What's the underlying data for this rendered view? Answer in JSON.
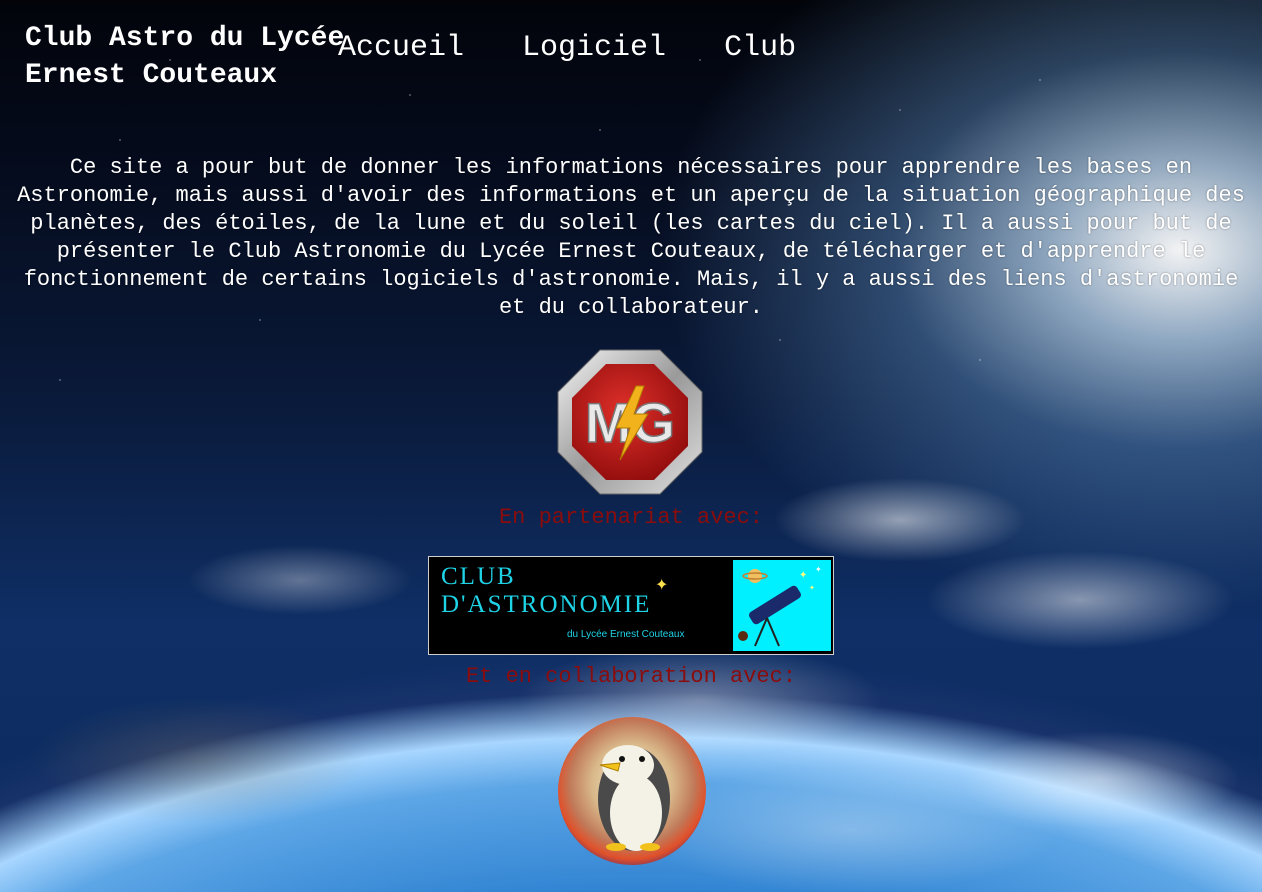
{
  "site": {
    "title": "Club Astro du Lycée Ernest Couteaux"
  },
  "nav": {
    "items": [
      {
        "label": "Accueil"
      },
      {
        "label": "Logiciel"
      },
      {
        "label": "Club"
      }
    ]
  },
  "intro": {
    "text": "Ce site a pour but de donner les informations nécessaires pour apprendre les bases en Astronomie, mais aussi d'avoir des informations et un aperçu de la situation géographique des planètes, des étoiles, de la lune et du soleil (les cartes du ciel). Il a aussi pour but de présenter le Club Astronomie du Lycée Ernest Couteaux, de télécharger et d'apprendre le fonctionnement de certains logiciels d'astronomie. Mais, il y a aussi des liens d'astronomie et du collaborateur."
  },
  "logos": {
    "mg": {
      "text": "MG"
    },
    "club_banner": {
      "line1": "CLUB",
      "line2": "D'ASTRONOMIE",
      "subtitle": "du Lycée Ernest Couteaux"
    }
  },
  "captions": {
    "partner": "En partenariat avec:",
    "collab": "Et en collaboration avec:"
  },
  "colors": {
    "caption": "#8b0c0c",
    "banner_accent": "#1fd3e6",
    "banner_picture_bg": "#00f0ff"
  }
}
